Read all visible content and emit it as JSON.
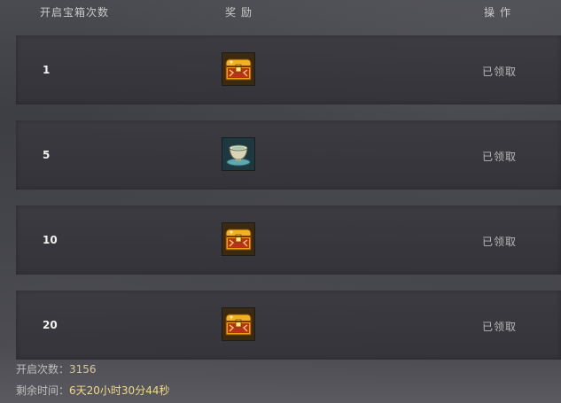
{
  "header": {
    "count_label": "开启宝箱次数",
    "reward_label": "奖励",
    "operation_label": "操作"
  },
  "rows": [
    {
      "count": "1",
      "reward_icon": "treasure-chest-icon",
      "status": "已领取"
    },
    {
      "count": "5",
      "reward_icon": "jade-cup-icon",
      "status": "已领取"
    },
    {
      "count": "10",
      "reward_icon": "treasure-chest-icon",
      "status": "已领取"
    },
    {
      "count": "20",
      "reward_icon": "treasure-chest-icon",
      "status": "已领取"
    }
  ],
  "footer": {
    "open_count_label": "开启次数：",
    "open_count_value": "3156",
    "remaining_label": "剩余时间：",
    "remaining_value": "6天20小时30分44秒"
  },
  "colors": {
    "chest_gold": "#f2b320",
    "chest_red": "#b8321a",
    "time_text": "#f3d98a"
  }
}
